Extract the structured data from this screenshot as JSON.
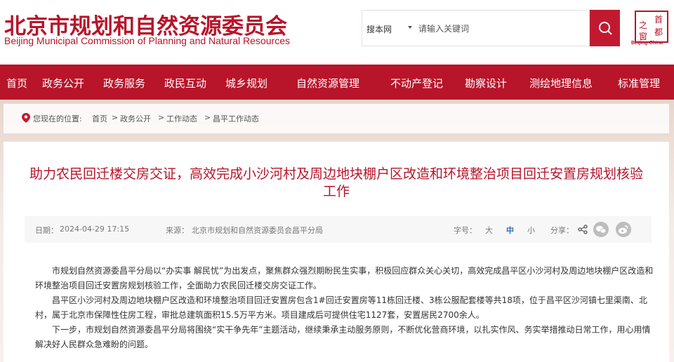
{
  "header": {
    "title_cn": "北京市规划和自然资源委员会",
    "title_en": "Beijing Municipal Commission of Planning and Natural Resources",
    "logo_text": [
      "首",
      "都",
      "之",
      "窗"
    ],
    "logo_caption": "Beijing-China"
  },
  "search": {
    "scope": "搜本网",
    "placeholder": "请输入关键词",
    "icon": "search-icon"
  },
  "nav": {
    "items": [
      "首页",
      "政务公开",
      "政务服务",
      "政民互动",
      "城乡规划",
      "自然资源管理",
      "不动产登记",
      "勘察设计",
      "测绘地理信息",
      "标准管理"
    ]
  },
  "breadcrumb": {
    "prefix": "您现在的位置:",
    "items": [
      "首页",
      "政务公开",
      "工作动态",
      "昌平工作动态"
    ],
    "separator": ">"
  },
  "article": {
    "title": "助力农民回迁楼交房交证，高效完成小沙河村及周边地块棚户区改造和环境整治项目回迁安置房规划核验工作",
    "date_label": "日期：",
    "date": "2024-04-29 17:15",
    "source_label": "来源：",
    "source": "北京市规划和自然资源委员会昌平分局",
    "fontsize_label": "字号：",
    "fontsizes": [
      "大",
      "中",
      "小"
    ],
    "share_label": "分享：",
    "paragraphs": [
      "市规划自然资源委昌平分局以“办实事 解民忧”为出发点，聚焦群众强烈期盼民生实事，积极回应群众关心关切，高效完成昌平区小沙河村及周边地块棚户区改造和环境整治项目回迁安置房规划核验工作，全面助力农民回迁楼交房交证工作。",
      "昌平区小沙河村及周边地块棚户区改造和环境整治项目回迁安置房包含1#回迁安置房等11栋回迁楼、3栋公服配套楼等共18项，位于昌平区沙河镇七里渠南、北村，属于北京市保障性住房工程，审批总建筑面积15.5万平方米。项目建成后可提供住宅1127套，安置居民2700余人。",
      "下一步，市规划自然资源委昌平分局将围绕“实干争先年”主题活动，继续秉承主动服务原则，不断优化营商环境，以扎实作风、务实举措推动日常工作，用心用情解决好人民群众急难盼的问题。"
    ]
  },
  "colors": {
    "brand_red": "#b8142a",
    "link_blue": "#2f6db4"
  }
}
